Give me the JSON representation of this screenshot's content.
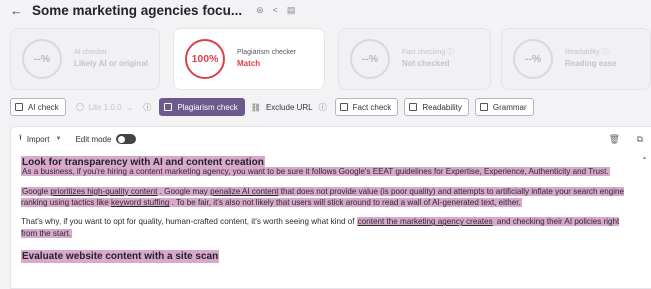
{
  "header": {
    "title": "Some marketing agencies focu...",
    "icons": [
      "arrow-left-icon",
      "refresh-icon",
      "share-icon",
      "document-icon"
    ]
  },
  "cards": [
    {
      "score": "--%",
      "label": "AI checker",
      "value": "Likely AI or original",
      "active": false
    },
    {
      "score": "100%",
      "label": "Plagiarism checker",
      "value": "Match",
      "active": true
    },
    {
      "score": "--%",
      "label": "Fact checking ⓘ",
      "value": "Not checked",
      "active": false
    },
    {
      "score": "--%",
      "label": "Readability ⓘ",
      "value": "Reading ease",
      "active": false
    }
  ],
  "checks": {
    "ai_check": "AI check",
    "lite": "Lite 1.0.0",
    "plagiarism": "Plagiarism check",
    "exclude_url": "Exclude URL",
    "fact_check": "Fact check",
    "readability": "Readability",
    "grammar": "Grammar"
  },
  "toolbar": {
    "import": "Import",
    "edit_mode": "Edit mode"
  },
  "content": {
    "heading1": "Look for transparency with AI and content creation",
    "p1": "As a business, if you're hiring a content marketing agency, you want to be sure it follows Google's EEAT guidelines for Expertise, Experience, Authenticity and Trust.",
    "p2_a": "Google ",
    "p2_b": "prioritizes high-quality content",
    "p2_c": " .  Google may ",
    "p2_d": "penalize AI content",
    "p2_e": " that does not provide value (is poor quality) and attempts to artificially inflate your search engine ranking using tactics like ",
    "p2_f": "keyword stuffing",
    "p2_g": " .  To be fair, it's also not likely that users will stick around to read a wall of AI-generated text, either.",
    "p3_a": "That's why, if you want to opt for quality, human-crafted content, it's worth seeing what kind of ",
    "p3_b": "content the marketing agency creates",
    "p3_c": " and checking their AI policies right from the start.",
    "heading2": "Evaluate website content with a site scan"
  },
  "colors": {
    "highlight": "#d9a9cb",
    "accent": "#6d5a8d",
    "match_red": "#d9424b"
  }
}
